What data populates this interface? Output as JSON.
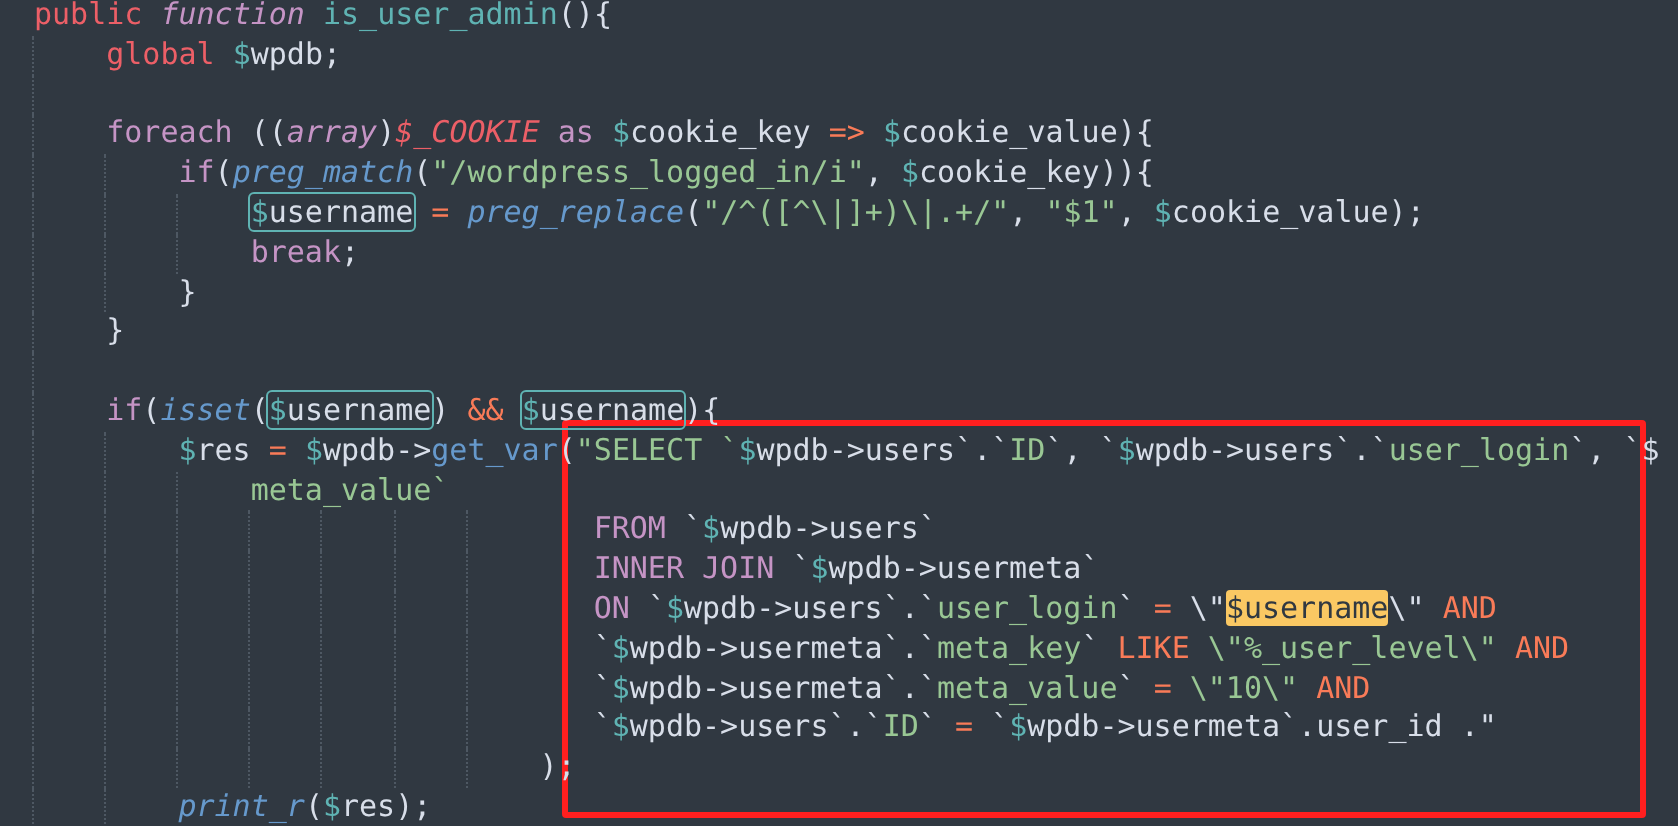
{
  "editor": {
    "lines": [
      {
        "kind": "code",
        "tokens": [
          {
            "kind": "keyword",
            "text": "public "
          },
          {
            "kind": "storage",
            "text": "function "
          },
          {
            "kind": "name",
            "text": "is_user_admin"
          },
          {
            "kind": "plain",
            "text": "(){"
          }
        ],
        "children": [
          {
            "kind": "code",
            "tokens": [
              {
                "kind": "keyword",
                "text": "global "
              },
              {
                "kind": "var",
                "text": "$wpdb"
              },
              {
                "kind": "plain",
                "text": ";"
              }
            ]
          },
          {
            "kind": "blank"
          },
          {
            "kind": "code",
            "tokens": [
              {
                "kind": "control",
                "text": "foreach"
              },
              {
                "kind": "plain",
                "text": " (("
              },
              {
                "kind": "cast",
                "text": "array"
              },
              {
                "kind": "plain",
                "text": ")"
              },
              {
                "kind": "super",
                "text": "$_COOKIE"
              },
              {
                "kind": "control",
                "text": " as "
              },
              {
                "kind": "var",
                "text": "$cookie_key"
              },
              {
                "kind": "op",
                "text": " => "
              },
              {
                "kind": "var",
                "text": "$cookie_value"
              },
              {
                "kind": "plain",
                "text": "){"
              }
            ],
            "children": [
              {
                "kind": "code",
                "tokens": [
                  {
                    "kind": "control",
                    "text": "if"
                  },
                  {
                    "kind": "plain",
                    "text": "("
                  },
                  {
                    "kind": "call",
                    "text": "preg_match"
                  },
                  {
                    "kind": "plain",
                    "text": "("
                  },
                  {
                    "kind": "string",
                    "text": "\"/wordpress_logged_in/i\""
                  },
                  {
                    "kind": "plain",
                    "text": ", "
                  },
                  {
                    "kind": "var",
                    "text": "$cookie_key"
                  },
                  {
                    "kind": "plain",
                    "text": ")){"
                  }
                ],
                "children": [
                  {
                    "kind": "code",
                    "tokens": [
                      {
                        "kind": "var",
                        "text": "$username",
                        "boxed": true
                      },
                      {
                        "kind": "op",
                        "text": " = "
                      },
                      {
                        "kind": "call",
                        "text": "preg_replace"
                      },
                      {
                        "kind": "plain",
                        "text": "("
                      },
                      {
                        "kind": "string",
                        "text": "\"/^([^\\|]+)\\|.+/\""
                      },
                      {
                        "kind": "plain",
                        "text": ", "
                      },
                      {
                        "kind": "string",
                        "text": "\"$1\""
                      },
                      {
                        "kind": "plain",
                        "text": ", "
                      },
                      {
                        "kind": "var",
                        "text": "$cookie_value"
                      },
                      {
                        "kind": "plain",
                        "text": ");"
                      }
                    ]
                  },
                  {
                    "kind": "code",
                    "tokens": [
                      {
                        "kind": "control",
                        "text": "break"
                      },
                      {
                        "kind": "plain",
                        "text": ";"
                      }
                    ]
                  }
                ]
              },
              {
                "kind": "code",
                "tokens": [
                  {
                    "kind": "plain",
                    "text": "}"
                  }
                ]
              }
            ]
          },
          {
            "kind": "code",
            "tokens": [
              {
                "kind": "plain",
                "text": "}"
              }
            ]
          },
          {
            "kind": "blank"
          },
          {
            "kind": "code",
            "tokens": [
              {
                "kind": "control",
                "text": "if"
              },
              {
                "kind": "plain",
                "text": "("
              },
              {
                "kind": "call",
                "text": "isset"
              },
              {
                "kind": "plain",
                "text": "("
              },
              {
                "kind": "var",
                "text": "$username",
                "boxed": true
              },
              {
                "kind": "plain",
                "text": ") "
              },
              {
                "kind": "op",
                "text": "&& "
              },
              {
                "kind": "var",
                "text": "$username",
                "boxed": true
              },
              {
                "kind": "plain",
                "text": "){"
              }
            ],
            "children": [
              {
                "kind": "code",
                "tokens": [
                  {
                    "kind": "var",
                    "text": "$res"
                  },
                  {
                    "kind": "op",
                    "text": " = "
                  },
                  {
                    "kind": "var",
                    "text": "$wpdb"
                  },
                  {
                    "kind": "plain",
                    "text": "->"
                  },
                  {
                    "kind": "method",
                    "text": "get_var"
                  },
                  {
                    "kind": "plain",
                    "text": "("
                  },
                  {
                    "kind": "string",
                    "text": "\"SELECT `"
                  },
                  {
                    "kind": "var",
                    "text": "$wpdb"
                  },
                  {
                    "kind": "plain",
                    "text": "->users`.`"
                  },
                  {
                    "kind": "string",
                    "text": "ID"
                  },
                  {
                    "kind": "plain",
                    "text": "`, `"
                  },
                  {
                    "kind": "var",
                    "text": "$wpdb"
                  },
                  {
                    "kind": "plain",
                    "text": "->users`.`"
                  },
                  {
                    "kind": "string",
                    "text": "user_login"
                  },
                  {
                    "kind": "plain",
                    "text": "`, `$"
                  }
                ],
                "children": [
                  {
                    "kind": "code",
                    "tokens": [
                      {
                        "kind": "string",
                        "text": "meta_value`"
                      }
                    ]
                  },
                  {
                    "kind": "sql",
                    "tokens": [
                      {
                        "kind": "sql",
                        "text": "FROM "
                      },
                      {
                        "kind": "plain",
                        "text": "`"
                      },
                      {
                        "kind": "var",
                        "text": "$wpdb"
                      },
                      {
                        "kind": "plain",
                        "text": "->users`"
                      }
                    ]
                  },
                  {
                    "kind": "sql",
                    "tokens": [
                      {
                        "kind": "sql",
                        "text": "INNER JOIN "
                      },
                      {
                        "kind": "plain",
                        "text": "`"
                      },
                      {
                        "kind": "var",
                        "text": "$wpdb"
                      },
                      {
                        "kind": "plain",
                        "text": "->usermeta`"
                      }
                    ]
                  },
                  {
                    "kind": "sql",
                    "tokens": [
                      {
                        "kind": "sql",
                        "text": "ON "
                      },
                      {
                        "kind": "plain",
                        "text": "`"
                      },
                      {
                        "kind": "var",
                        "text": "$wpdb"
                      },
                      {
                        "kind": "plain",
                        "text": "->users`.`"
                      },
                      {
                        "kind": "string",
                        "text": "user_login"
                      },
                      {
                        "kind": "plain",
                        "text": "` "
                      },
                      {
                        "kind": "op",
                        "text": "="
                      },
                      {
                        "kind": "plain",
                        "text": " \\\""
                      },
                      {
                        "kind": "var",
                        "text": "$username",
                        "highlighted": true
                      },
                      {
                        "kind": "plain",
                        "text": "\\\" "
                      },
                      {
                        "kind": "sqlop",
                        "text": "AND"
                      }
                    ]
                  },
                  {
                    "kind": "sql",
                    "tokens": [
                      {
                        "kind": "plain",
                        "text": "`"
                      },
                      {
                        "kind": "var",
                        "text": "$wpdb"
                      },
                      {
                        "kind": "plain",
                        "text": "->usermeta`.`"
                      },
                      {
                        "kind": "string",
                        "text": "meta_key"
                      },
                      {
                        "kind": "plain",
                        "text": "` "
                      },
                      {
                        "kind": "sqlop",
                        "text": "LIKE"
                      },
                      {
                        "kind": "string",
                        "text": " \\\"%_user_level\\\" "
                      },
                      {
                        "kind": "sqlop",
                        "text": "AND"
                      }
                    ]
                  },
                  {
                    "kind": "sql",
                    "tokens": [
                      {
                        "kind": "plain",
                        "text": "`"
                      },
                      {
                        "kind": "var",
                        "text": "$wpdb"
                      },
                      {
                        "kind": "plain",
                        "text": "->usermeta`.`"
                      },
                      {
                        "kind": "string",
                        "text": "meta_value"
                      },
                      {
                        "kind": "plain",
                        "text": "` "
                      },
                      {
                        "kind": "op",
                        "text": "="
                      },
                      {
                        "kind": "string",
                        "text": " \\\"10\\\" "
                      },
                      {
                        "kind": "sqlop",
                        "text": "AND"
                      }
                    ]
                  },
                  {
                    "kind": "sql",
                    "tokens": [
                      {
                        "kind": "plain",
                        "text": "`"
                      },
                      {
                        "kind": "var",
                        "text": "$wpdb"
                      },
                      {
                        "kind": "plain",
                        "text": "->users`.`"
                      },
                      {
                        "kind": "string",
                        "text": "ID"
                      },
                      {
                        "kind": "plain",
                        "text": "` "
                      },
                      {
                        "kind": "op",
                        "text": "="
                      },
                      {
                        "kind": "plain",
                        "text": " `"
                      },
                      {
                        "kind": "var",
                        "text": "$wpdb"
                      },
                      {
                        "kind": "plain",
                        "text": "->usermeta`.user_id .\""
                      }
                    ]
                  },
                  {
                    "kind": "close",
                    "tokens": [
                      {
                        "kind": "plain",
                        "text": ");"
                      }
                    ]
                  }
                ]
              },
              {
                "kind": "code",
                "tokens": [
                  {
                    "kind": "call",
                    "text": "print_r"
                  },
                  {
                    "kind": "plain",
                    "text": "("
                  },
                  {
                    "kind": "var",
                    "text": "$res"
                  },
                  {
                    "kind": "plain",
                    "text": ");"
                  }
                ]
              }
            ]
          }
        ]
      }
    ]
  },
  "annotation": {
    "kind": "rectangle"
  }
}
